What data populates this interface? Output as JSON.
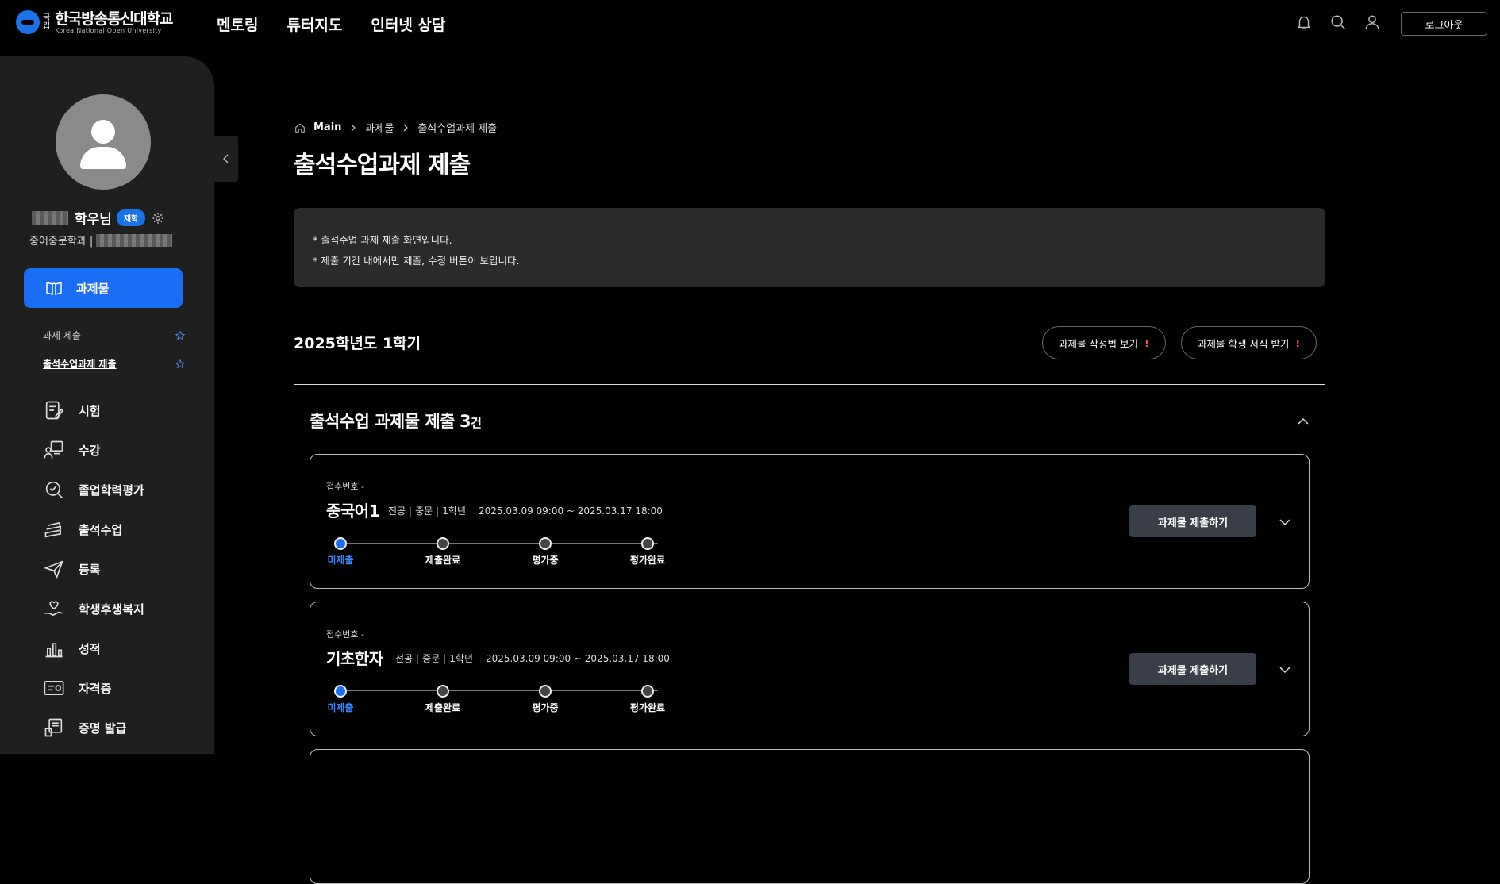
{
  "header": {
    "logo_kr_top": "국",
    "logo_kr_bottom": "립",
    "logo_name": "한국방송통신대학교",
    "logo_sub": "Korea National Open University",
    "nav": [
      "멘토링",
      "튜터지도",
      "인터넷 상담"
    ],
    "logout_label": "로그아웃"
  },
  "sidebar": {
    "user_suffix": "학우님",
    "badge": "재학",
    "dept": "중어중문학과 |",
    "active_menu": "과제물",
    "sub_items": [
      "과제 제출",
      "출석수업과제 제출"
    ],
    "menu_items": [
      "시험",
      "수강",
      "졸업학력평가",
      "출석수업",
      "등록",
      "학생후생복지",
      "성적",
      "자격증",
      "증명 발급"
    ]
  },
  "breadcrumb": [
    "Main",
    "과제물",
    "출석수업과제 제출"
  ],
  "page_title": "출석수업과제 제출",
  "notice": [
    "* 출석수업 과제 제출 화면입니다.",
    "* 제출 기간 내에서만 제출, 수정 버튼이 보입니다."
  ],
  "semester": "2025학년도 1학기",
  "buttons": {
    "guide": "과제물 작성법 보기",
    "form": "과제물 학생 서식 받기",
    "mark": "!"
  },
  "section": {
    "title": "출석수업 과제물 제출",
    "count": "3",
    "unit": "건"
  },
  "cards": [
    {
      "receipt": "접수번호 -",
      "course": "중국어1",
      "meta": [
        "전공",
        "중문",
        "1학년"
      ],
      "period": "2025.03.09 09:00 ~ 2025.03.17 18:00",
      "submit": "과제물 제출하기"
    },
    {
      "receipt": "접수번호 -",
      "course": "기초한자",
      "meta": [
        "전공",
        "중문",
        "1학년"
      ],
      "period": "2025.03.09 09:00 ~ 2025.03.17 18:00",
      "submit": "과제물 제출하기"
    }
  ],
  "steps": [
    "미제출",
    "제출완료",
    "평가중",
    "평가완료"
  ],
  "colors": {
    "accent": "#1a6ef5",
    "sidebar_bg": "#1f1f1f",
    "notice_bg": "#2a2a2a",
    "warn": "#ff4d4d"
  }
}
